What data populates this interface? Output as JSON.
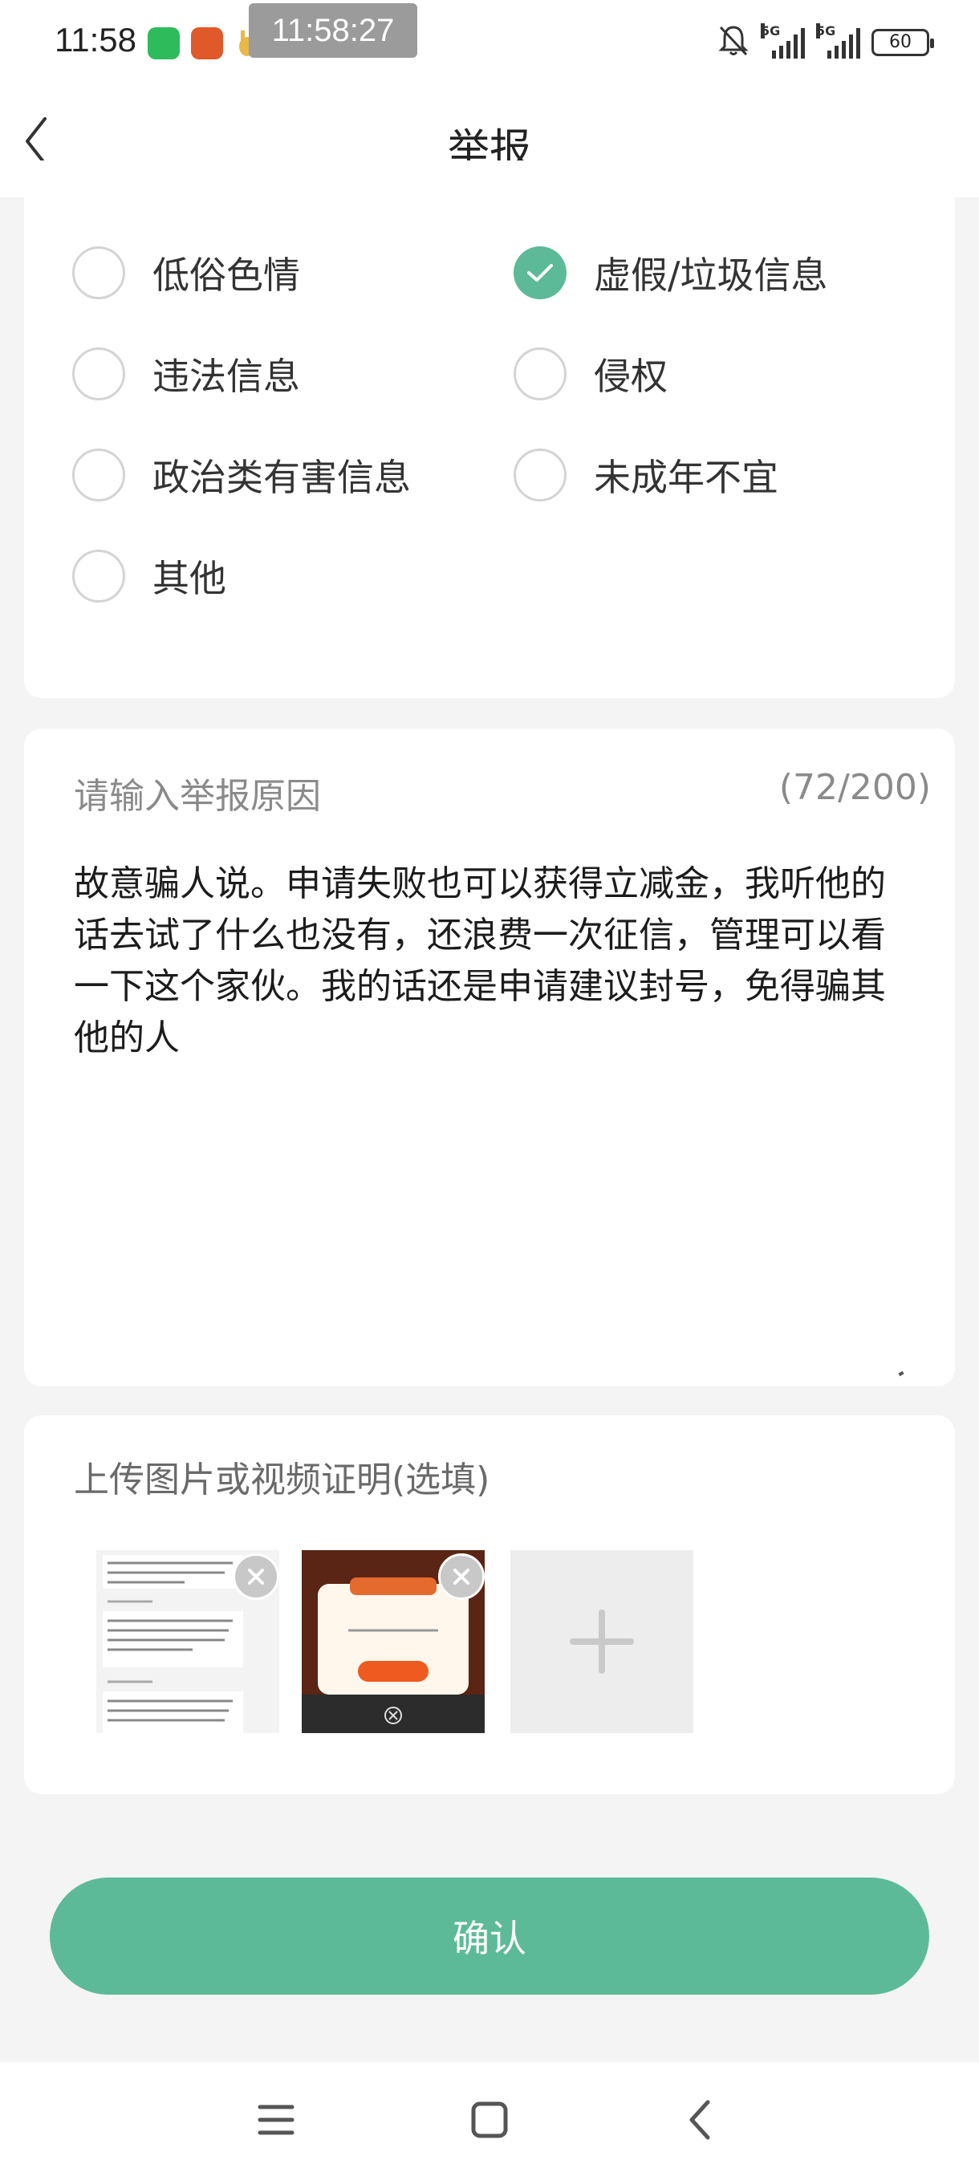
{
  "status_bar": {
    "time": "11:58",
    "clock_overlay": "11:58:27",
    "network1": "5G",
    "network2": "5G",
    "battery": "60"
  },
  "header": {
    "title": "举报",
    "back_icon": "chevron-left-icon"
  },
  "options": [
    {
      "label": "低俗色情",
      "checked": false
    },
    {
      "label": "虚假/垃圾信息",
      "checked": true
    },
    {
      "label": "违法信息",
      "checked": false
    },
    {
      "label": "侵权",
      "checked": false
    },
    {
      "label": "政治类有害信息",
      "checked": false
    },
    {
      "label": "未成年不宜",
      "checked": false
    },
    {
      "label": "其他",
      "checked": false
    }
  ],
  "reason": {
    "label": "请输入举报原因",
    "count": "(72/200)",
    "text": "故意骗人说。申请失败也可以获得立减金，我听他的话去试了什么也没有，还浪费一次征信，管理可以看一下这个家伙。我的话还是申请建议封号，免得骗其他的人"
  },
  "upload": {
    "label": "上传图片或视频证明(选填)"
  },
  "confirm_label": "确认",
  "colors": {
    "accent": "#5dba98",
    "background": "#f4f4f4"
  }
}
